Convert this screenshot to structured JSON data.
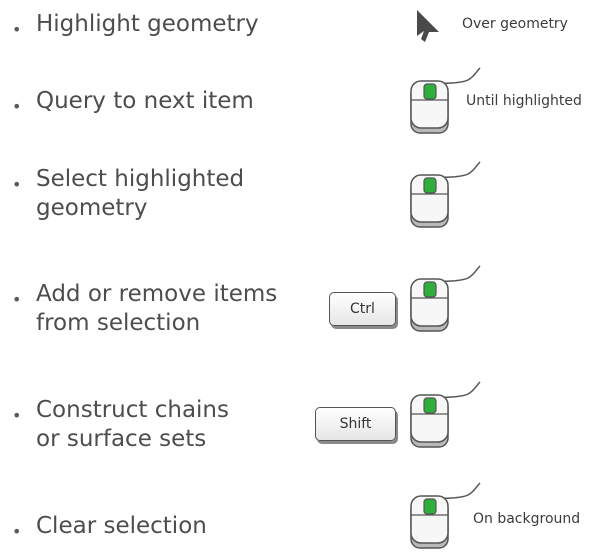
{
  "colors": {
    "accent_green": "#2fae3c",
    "text": "#4d4d4d"
  },
  "rows": [
    {
      "label_lines": [
        "Highlight geometry"
      ],
      "icon": "arrow-cursor-icon",
      "hint": "Over geometry"
    },
    {
      "label_lines": [
        "Query to next item"
      ],
      "icon": "mouse-left-click-icon",
      "hint": "Until highlighted"
    },
    {
      "label_lines": [
        "Select highlighted",
        "geometry"
      ],
      "icon": "mouse-left-click-icon",
      "hint": ""
    },
    {
      "label_lines": [
        "Add or remove items",
        "from selection"
      ],
      "icon": "mouse-left-click-icon",
      "key": "Ctrl",
      "hint": ""
    },
    {
      "label_lines": [
        "Construct chains",
        "or surface sets"
      ],
      "icon": "mouse-left-click-icon",
      "key": "Shift",
      "hint": ""
    },
    {
      "label_lines": [
        "Clear selection"
      ],
      "icon": "mouse-left-click-icon",
      "hint": "On background"
    }
  ]
}
